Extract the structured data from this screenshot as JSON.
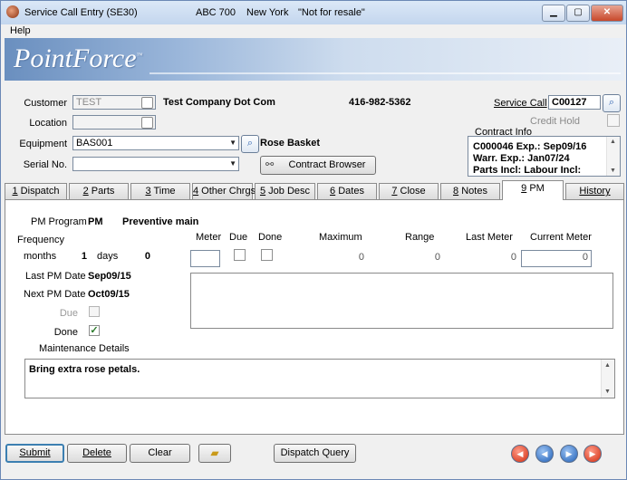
{
  "window": {
    "title": "Service Call Entry (SE30)",
    "company": "ABC 700",
    "location": "New York",
    "notice": "\"Not for resale\"",
    "min": "▁",
    "max": "▢",
    "close": "✕"
  },
  "menu": {
    "help": "Help"
  },
  "brand": {
    "logo": "PointForce",
    "tm": "™"
  },
  "header": {
    "customer_label": "Customer",
    "customer_value": "TEST",
    "customer_name": "Test Company Dot Com",
    "phone": "416-982-5362",
    "location_label": "Location",
    "location_value": "",
    "equipment_label": "Equipment",
    "equipment_value": "BAS001",
    "equipment_desc": "Rose Basket",
    "serial_label": "Serial No.",
    "serial_value": "",
    "contract_browser": "Contract Browser",
    "service_call_label": "Service Call",
    "service_call_value": "C00127",
    "credit_hold_label": "Credit Hold",
    "contract_info_label": "Contract Info",
    "contract_lines": [
      "C000046   Exp.: Sep09/16",
      "Warr. Exp.: Jan07/24",
      "Parts Incl:   Labour Incl:"
    ]
  },
  "tabs": [
    {
      "key": "1",
      "label": " Dispatch"
    },
    {
      "key": "2",
      "label": " Parts"
    },
    {
      "key": "3",
      "label": " Time"
    },
    {
      "key": "4",
      "label": " Other Chrgs"
    },
    {
      "key": "5",
      "label": " Job Desc"
    },
    {
      "key": "6",
      "label": " Dates"
    },
    {
      "key": "7",
      "label": " Close"
    },
    {
      "key": "8",
      "label": " Notes"
    },
    {
      "key": "9",
      "label": " PM"
    },
    {
      "key": "",
      "label": "History"
    }
  ],
  "pm": {
    "program_label": "PM Program",
    "program_code": "PM",
    "program_desc": "Preventive main",
    "frequency_label": "Frequency",
    "months_label": "months",
    "months_value": "1",
    "days_label": "days",
    "days_value": "0",
    "last_pm_label": "Last PM Date",
    "last_pm_value": "Sep09/15",
    "next_pm_label": "Next PM Date",
    "next_pm_value": "Oct09/15",
    "due_label": "Due",
    "done_label": "Done",
    "done_checked": "✓",
    "maintenance_label": "Maintenance Details",
    "maintenance_text": "Bring extra rose petals.",
    "meter_headers": {
      "meter": "Meter",
      "due": "Due",
      "done": "Done",
      "maximum": "Maximum",
      "range": "Range",
      "last_meter": "Last Meter",
      "current_meter": "Current Meter"
    },
    "meter_row": {
      "meter": "",
      "maximum": "0",
      "range": "0",
      "last_meter": "0",
      "current_meter": "0"
    }
  },
  "footer": {
    "submit": "Submit",
    "delete": "Delete",
    "clear": "Clear",
    "dispatch_query": "Dispatch Query"
  }
}
